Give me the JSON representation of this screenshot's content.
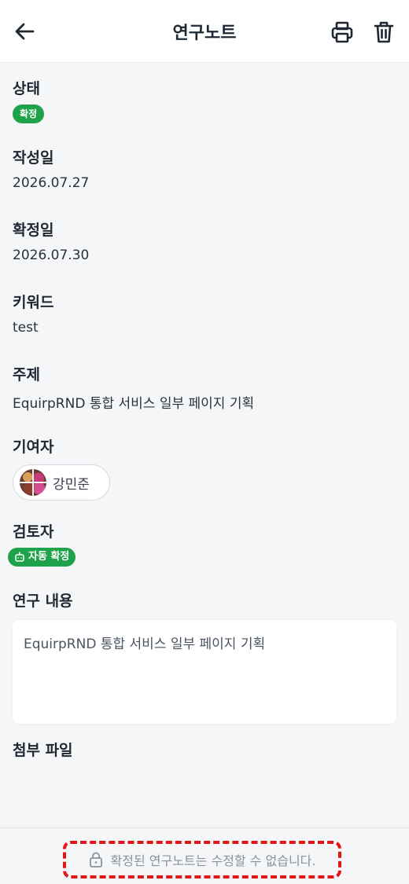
{
  "header": {
    "title": "연구노트",
    "back_icon": "arrow-left-icon",
    "print_icon": "printer-icon",
    "delete_icon": "trash-icon"
  },
  "fields": {
    "status": {
      "label": "상태",
      "value": "확정",
      "color": "#1fa34a"
    },
    "created_date": {
      "label": "작성일",
      "value": "2026.07.27"
    },
    "confirmed_date": {
      "label": "확정일",
      "value": "2026.07.30"
    },
    "keyword": {
      "label": "키워드",
      "value": "test"
    },
    "subject": {
      "label": "주제",
      "value": "EquirpRND 통합 서비스 일부 페이지 기획"
    },
    "contributor": {
      "label": "기여자",
      "name": "강민준"
    },
    "reviewer": {
      "label": "검토자",
      "value": "자동 확정",
      "icon": "robot-icon"
    },
    "research_content": {
      "label": "연구 내용",
      "value": "EquirpRND 통합 서비스 일부 페이지 기획"
    },
    "attachments": {
      "label": "첨부 파일"
    }
  },
  "footer": {
    "notice": "확정된 연구노트는 수정할 수 없습니다.",
    "icon": "lock-icon",
    "highlight_color": "#e11717"
  }
}
